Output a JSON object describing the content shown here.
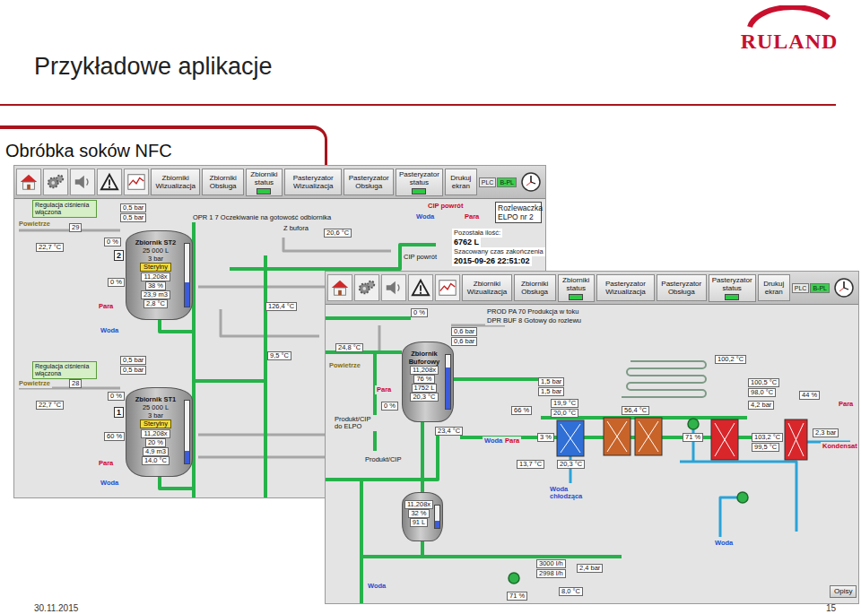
{
  "slide": {
    "title": "Przykładowe aplikacje",
    "section": "Obróbka soków NFC",
    "logo": "RULAND",
    "date": "30.11.2015",
    "page": "15"
  },
  "screens": [
    {
      "toolbar": [
        {
          "label": "Zbiorniki Wizualizacja",
          "kind": "button",
          "on": false
        },
        {
          "label": "Zbiorniki Obsługa",
          "kind": "button",
          "on": false
        },
        {
          "label": "Zbiorniki status",
          "kind": "status",
          "on": true
        },
        {
          "label": "Pasteryzator Wizualizacja",
          "kind": "button",
          "on": false
        },
        {
          "label": "Pasteryzator Obsługa",
          "kind": "button",
          "on": false
        },
        {
          "label": "Pasteryzator status",
          "kind": "status",
          "on": true
        },
        {
          "label": "Drukuj ekran",
          "kind": "button",
          "on": false
        }
      ],
      "plc": [
        {
          "label": "PLC",
          "on": false
        },
        {
          "label": "B-PL",
          "on": true
        }
      ],
      "tanks": [
        {
          "number": "2",
          "name": "Zbiornik ST2",
          "lines": [
            "25 000 L",
            "3 bar"
          ],
          "status": "Sterylny",
          "readings": [
            "11,208x",
            "38 %",
            "23,9 m3",
            "2,8 °C"
          ],
          "level": 0.38
        },
        {
          "number": "1",
          "name": "Zbiornik ST1",
          "lines": [
            "25 000 L",
            "3 bar"
          ],
          "status": "Sterylny",
          "readings": [
            "11,208x",
            "20 %",
            "4,9 m3",
            "14,0 °C"
          ],
          "level": 0.2
        }
      ],
      "labels": [
        {
          "text": "OPR 1 7 Oczekiwanie na gotowość odbiornika",
          "kind": "text"
        },
        {
          "text": "CIP powrót",
          "kind": "steam"
        },
        {
          "text": "Woda",
          "kind": "water"
        },
        {
          "text": "Para",
          "kind": "steam"
        },
        {
          "text": "Rozlewaczka ELPO nr 2",
          "kind": "panel"
        },
        {
          "text": "Pozostała ilość:",
          "kind": "info"
        },
        {
          "text": "6762 L",
          "kind": "infobold"
        },
        {
          "text": "Szacowany czas zakończenia",
          "kind": "info"
        },
        {
          "text": "2015-09-26 22:51:02",
          "kind": "infobold"
        },
        {
          "text": "Z bufora",
          "kind": "text"
        },
        {
          "text": "20,6 °C",
          "kind": "value"
        },
        {
          "text": "CIP powrót",
          "kind": "text"
        },
        {
          "text": "Regulacja ciśnienia włączona",
          "kind": "note"
        },
        {
          "text": "Powietrze",
          "kind": "air"
        },
        {
          "text": "0,5 bar",
          "kind": "value"
        },
        {
          "text": "0,5 bar",
          "kind": "value"
        },
        {
          "text": "29",
          "kind": "value"
        },
        {
          "text": "22,7 °C",
          "kind": "value"
        },
        {
          "text": "0 %",
          "kind": "value"
        },
        {
          "text": "0 %",
          "kind": "value"
        },
        {
          "text": "Para",
          "kind": "steam"
        },
        {
          "text": "Woda",
          "kind": "water"
        },
        {
          "text": "126,4 °C",
          "kind": "value"
        },
        {
          "text": "9,5 °C",
          "kind": "value"
        },
        {
          "text": "Regulacja ciśnienia włączona",
          "kind": "note"
        },
        {
          "text": "Powietrze",
          "kind": "air"
        },
        {
          "text": "0,5 bar",
          "kind": "value"
        },
        {
          "text": "0,5 bar",
          "kind": "value"
        },
        {
          "text": "28",
          "kind": "value"
        },
        {
          "text": "22,7 °C",
          "kind": "value"
        },
        {
          "text": "0 %",
          "kind": "value"
        },
        {
          "text": "60 %",
          "kind": "value"
        },
        {
          "text": "Para",
          "kind": "steam"
        },
        {
          "text": "Woda",
          "kind": "water"
        }
      ],
      "buttons": []
    },
    {
      "toolbar": [
        {
          "label": "Zbiorniki Wizualizacja",
          "kind": "button",
          "on": false
        },
        {
          "label": "Zbiorniki Obsługa",
          "kind": "button",
          "on": false
        },
        {
          "label": "Zbiorniki status",
          "kind": "status",
          "on": true
        },
        {
          "label": "Pasteryzator Wizualizacja",
          "kind": "button",
          "on": false
        },
        {
          "label": "Pasteryzator Obsługa",
          "kind": "button",
          "on": false
        },
        {
          "label": "Pasteryzator status",
          "kind": "status",
          "on": true
        },
        {
          "label": "Drukuj ekran",
          "kind": "button",
          "on": false
        }
      ],
      "plc": [
        {
          "label": "PLC",
          "on": false
        },
        {
          "label": "B-PL",
          "on": true
        }
      ],
      "tanks": [
        {
          "name": "Zbiornik Buforowy",
          "lines": [],
          "readings": [
            "11,208x",
            "76 %",
            "1752 L",
            "20,3 °C"
          ],
          "level": 0.76
        },
        {
          "lines": [],
          "readings": [
            "11,208x",
            "32 %",
            "91 L"
          ],
          "level": 0.32
        }
      ],
      "labels": [
        {
          "text": "PROD PA 70 Produkcja w toku",
          "kind": "text"
        },
        {
          "text": "DPR BUF 8 Gotowy do rozlewu",
          "kind": "text"
        },
        {
          "text": "0 %",
          "kind": "value"
        },
        {
          "text": "0,6 bar",
          "kind": "value"
        },
        {
          "text": "0,6 bar",
          "kind": "value"
        },
        {
          "text": "24,8 °C",
          "kind": "value"
        },
        {
          "text": "Powietrze",
          "kind": "air"
        },
        {
          "text": "Para",
          "kind": "steam"
        },
        {
          "text": "0 %",
          "kind": "value"
        },
        {
          "text": "23,4 °C",
          "kind": "value"
        },
        {
          "text": "Woda",
          "kind": "water"
        },
        {
          "text": "Para",
          "kind": "steam"
        },
        {
          "text": "66 %",
          "kind": "value"
        },
        {
          "text": "3 %",
          "kind": "value"
        },
        {
          "text": "1,5 bar",
          "kind": "value"
        },
        {
          "text": "1,5 bar",
          "kind": "value"
        },
        {
          "text": "19,9 °C",
          "kind": "value"
        },
        {
          "text": "20,0 °C",
          "kind": "value"
        },
        {
          "text": "56,4 °C",
          "kind": "value"
        },
        {
          "text": "13,7 °C",
          "kind": "value"
        },
        {
          "text": "20,3 °C",
          "kind": "value"
        },
        {
          "text": "Woda chłodząca",
          "kind": "water"
        },
        {
          "text": "71 %",
          "kind": "value"
        },
        {
          "text": "100,2 °C",
          "kind": "value"
        },
        {
          "text": "100,5 °C",
          "kind": "value"
        },
        {
          "text": "98,0 °C",
          "kind": "value"
        },
        {
          "text": "4,2 bar",
          "kind": "value"
        },
        {
          "text": "44 %",
          "kind": "value"
        },
        {
          "text": "Para",
          "kind": "steam"
        },
        {
          "text": "2,3 bar",
          "kind": "value"
        },
        {
          "text": "103,2 °C",
          "kind": "value"
        },
        {
          "text": "99,5 °C",
          "kind": "value"
        },
        {
          "text": "Kondensat",
          "kind": "steam"
        },
        {
          "text": "Woda",
          "kind": "water"
        },
        {
          "text": "3000 l/h",
          "kind": "value"
        },
        {
          "text": "2998 l/h",
          "kind": "value"
        },
        {
          "text": "2,4 bar",
          "kind": "value"
        },
        {
          "text": "8,0 °C",
          "kind": "value"
        },
        {
          "text": "71 %",
          "kind": "value"
        },
        {
          "text": "Woda",
          "kind": "water"
        },
        {
          "text": "Produkt/CIP do ELPO",
          "kind": "text"
        },
        {
          "text": "Produkt/CIP",
          "kind": "text"
        }
      ],
      "buttons": [
        "Opisy"
      ]
    }
  ]
}
